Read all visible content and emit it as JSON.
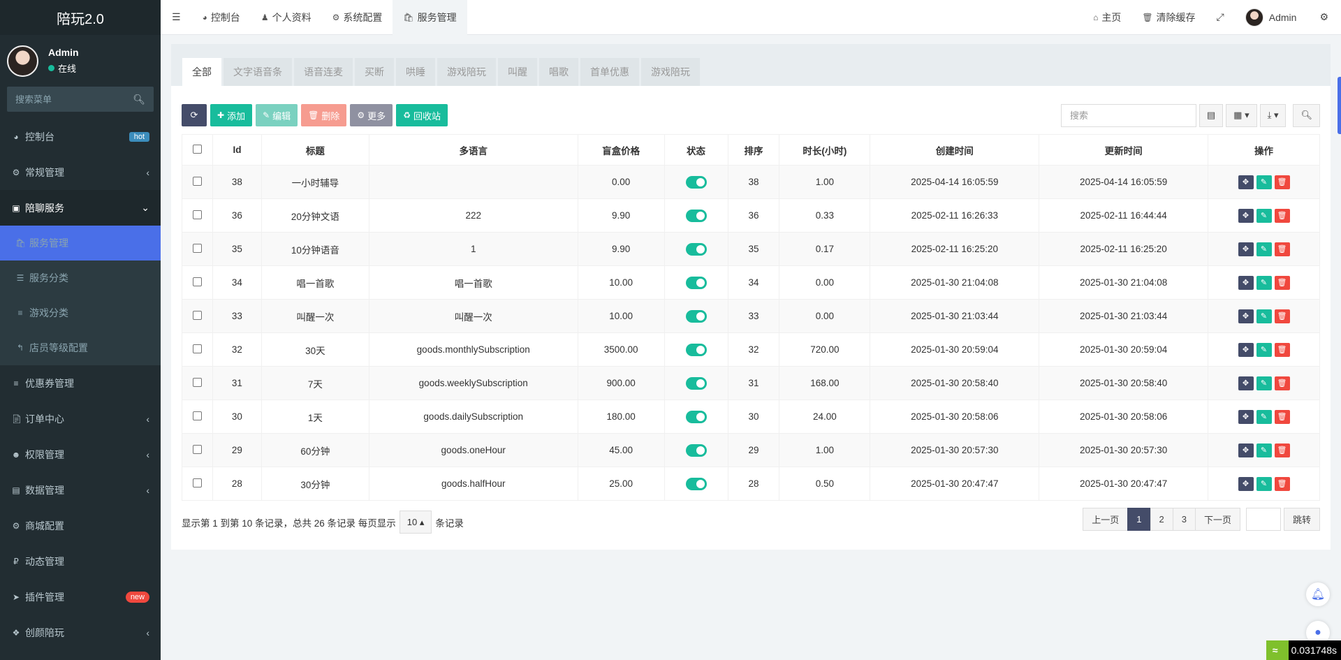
{
  "app": {
    "title": "陪玩2.0"
  },
  "user": {
    "name": "Admin",
    "status": "在线"
  },
  "sidebar": {
    "search_placeholder": "搜索菜单",
    "items": [
      {
        "label": "控制台",
        "icon": "dashboard-icon",
        "badge": "hot"
      },
      {
        "label": "常规管理",
        "icon": "cogs-icon"
      },
      {
        "label": "陪聊服务",
        "icon": "inbox-icon"
      },
      {
        "label": "服务管理",
        "icon": "shopping-bag-icon"
      },
      {
        "label": "服务分类",
        "icon": "sitemap-icon"
      },
      {
        "label": "游戏分类",
        "icon": "list-icon"
      },
      {
        "label": "店员等级配置",
        "icon": "level-up-icon"
      },
      {
        "label": "优惠券管理",
        "icon": "list-icon"
      },
      {
        "label": "订单中心",
        "icon": "file-icon"
      },
      {
        "label": "权限管理",
        "icon": "group-icon"
      },
      {
        "label": "数据管理",
        "icon": "bar-chart-icon"
      },
      {
        "label": "商城配置",
        "icon": "cogs-icon"
      },
      {
        "label": "动态管理",
        "icon": "ruble-icon"
      },
      {
        "label": "插件管理",
        "icon": "rocket-icon",
        "badge": "new"
      },
      {
        "label": "创颜陪玩",
        "icon": "dropbox-icon"
      }
    ]
  },
  "topbar": {
    "tabs": [
      "控制台",
      "个人资料",
      "系统配置",
      "服务管理"
    ],
    "home": "主页",
    "clear_cache": "清除缓存",
    "user": "Admin"
  },
  "filter_tabs": [
    "全部",
    "文字语音条",
    "语音连麦",
    "买断",
    "哄睡",
    "游戏陪玩",
    "叫醒",
    "唱歌",
    "首单优惠",
    "游戏陪玩"
  ],
  "toolbar": {
    "add": "添加",
    "edit": "编辑",
    "delete": "删除",
    "more": "更多",
    "recycle": "回收站",
    "search_placeholder": "搜索"
  },
  "table": {
    "headers": [
      "Id",
      "标题",
      "多语言",
      "盲盒价格",
      "状态",
      "排序",
      "时长(小时)",
      "创建时间",
      "更新时间",
      "操作"
    ],
    "rows": [
      [
        "38",
        "一小时辅导",
        "",
        "0.00",
        "38",
        "1.00",
        "2025-04-14 16:05:59",
        "2025-04-14 16:05:59"
      ],
      [
        "36",
        "20分钟文语",
        "222",
        "9.90",
        "36",
        "0.33",
        "2025-02-11 16:26:33",
        "2025-02-11 16:44:44"
      ],
      [
        "35",
        "10分钟语音",
        "1",
        "9.90",
        "35",
        "0.17",
        "2025-02-11 16:25:20",
        "2025-02-11 16:25:20"
      ],
      [
        "34",
        "唱一首歌",
        "唱一首歌",
        "10.00",
        "34",
        "0.00",
        "2025-01-30 21:04:08",
        "2025-01-30 21:04:08"
      ],
      [
        "33",
        "叫醒一次",
        "叫醒一次",
        "10.00",
        "33",
        "0.00",
        "2025-01-30 21:03:44",
        "2025-01-30 21:03:44"
      ],
      [
        "32",
        "30天",
        "goods.monthlySubscription",
        "3500.00",
        "32",
        "720.00",
        "2025-01-30 20:59:04",
        "2025-01-30 20:59:04"
      ],
      [
        "31",
        "7天",
        "goods.weeklySubscription",
        "900.00",
        "31",
        "168.00",
        "2025-01-30 20:58:40",
        "2025-01-30 20:58:40"
      ],
      [
        "30",
        "1天",
        "goods.dailySubscription",
        "180.00",
        "30",
        "24.00",
        "2025-01-30 20:58:06",
        "2025-01-30 20:58:06"
      ],
      [
        "29",
        "60分钟",
        "goods.oneHour",
        "45.00",
        "29",
        "1.00",
        "2025-01-30 20:57:30",
        "2025-01-30 20:57:30"
      ],
      [
        "28",
        "30分钟",
        "goods.halfHour",
        "25.00",
        "28",
        "0.50",
        "2025-01-30 20:47:47",
        "2025-01-30 20:47:47"
      ]
    ]
  },
  "pagination": {
    "summary": "显示第 1 到第 10 条记录，总共 26 条记录 每页显示",
    "page_size": "10",
    "suffix": "条记录",
    "prev": "上一页",
    "pages": [
      "1",
      "2",
      "3"
    ],
    "next": "下一页",
    "go": "跳转"
  },
  "timer": "0.031748s",
  "colors": {
    "accent": "#4a6fe8",
    "green": "#18bc9c",
    "dark": "#444c69",
    "sidebar": "#222d32"
  }
}
